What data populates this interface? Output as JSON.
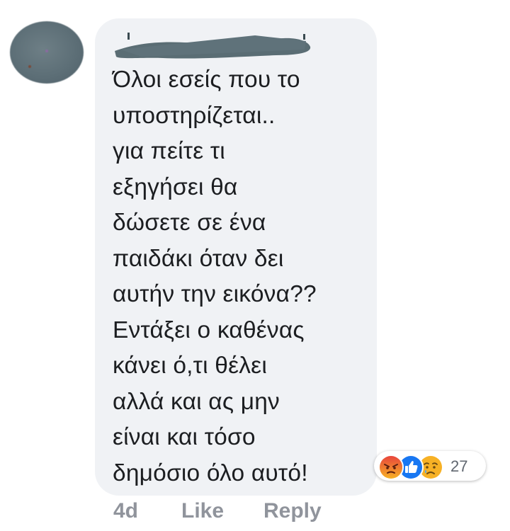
{
  "comment": {
    "author_name_redacted": true,
    "text": "Όλοι εσείς που το\nυποστηρίζεται..\nγια πείτε τι\nεξηγήσει θα\nδώσετε σε ένα\nπαιδάκι όταν δει\nαυτήν την εικόνα??\nΕντάξει ο καθένας\nκάνει ό,τι θέλει\nαλλά και ας μην\nείναι και τόσο\nδημόσιο όλο αυτό!"
  },
  "reactions": {
    "icons": [
      "angry-icon",
      "like-icon",
      "sad-icon"
    ],
    "count": "27",
    "colors": {
      "angry_top": "#e8453c",
      "angry_bottom": "#f7b125",
      "like": "#1877f2",
      "sad": "#f7b125"
    }
  },
  "actions": {
    "timestamp": "4d",
    "like_label": "Like",
    "reply_label": "Reply"
  },
  "colors": {
    "bubble_bg": "#f0f2f5",
    "text": "#1c1e21",
    "meta_text": "#90949c",
    "redaction": "#5a6d74"
  }
}
